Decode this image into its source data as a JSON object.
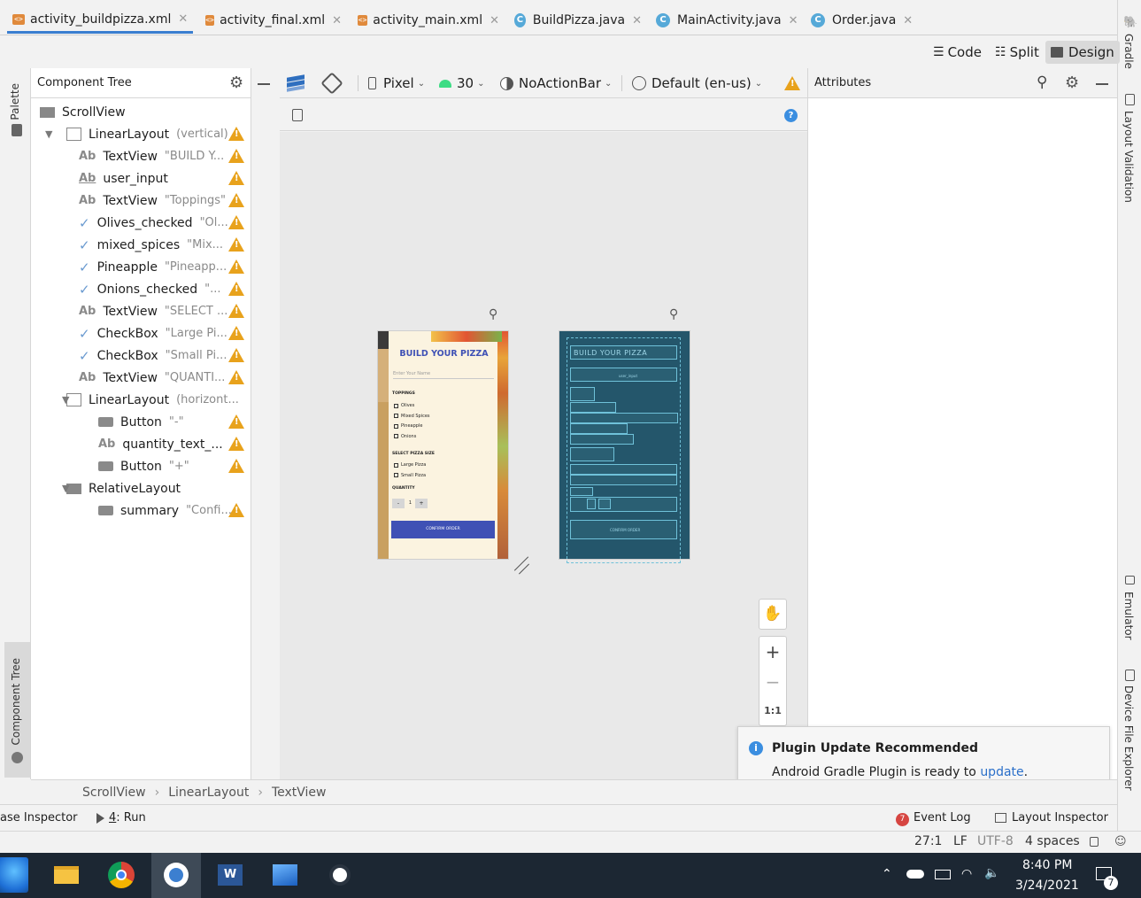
{
  "tabs": [
    {
      "label": "activity_buildpizza.xml",
      "type": "xml",
      "active": true
    },
    {
      "label": "activity_final.xml",
      "type": "xml"
    },
    {
      "label": "activity_main.xml",
      "type": "xml"
    },
    {
      "label": "BuildPizza.java",
      "type": "java"
    },
    {
      "label": "MainActivity.java",
      "type": "java"
    },
    {
      "label": "Order.java",
      "type": "java"
    }
  ],
  "view_modes": {
    "code": "Code",
    "split": "Split",
    "design": "Design",
    "active": "Design"
  },
  "left_strip": {
    "palette": "Palette",
    "component_tree": "Component Tree"
  },
  "right_strip": {
    "gradle": "Gradle",
    "layout_validation": "Layout Validation",
    "emulator": "Emulator",
    "device_file_explorer": "Device File Explorer"
  },
  "component_tree": {
    "title": "Component Tree",
    "rows": [
      {
        "icon": "scrollview",
        "name": "ScrollView",
        "attr": "",
        "warn": false
      },
      {
        "icon": "linearlayout-v",
        "name": "LinearLayout",
        "attr": "(vertical)",
        "warn": true,
        "expanded": true
      },
      {
        "icon": "textview",
        "name": "TextView",
        "attr": "\"BUILD Y...",
        "warn": true
      },
      {
        "icon": "edittext",
        "name": "user_input",
        "attr": "",
        "warn": true
      },
      {
        "icon": "textview",
        "name": "TextView",
        "attr": "\"Toppings\"",
        "warn": true
      },
      {
        "icon": "checkbox",
        "name": "Olives_checked",
        "attr": "\"Ol...",
        "warn": true
      },
      {
        "icon": "checkbox",
        "name": "mixed_spices",
        "attr": "\"Mix...",
        "warn": true
      },
      {
        "icon": "checkbox",
        "name": "Pineapple",
        "attr": "\"Pineapp...",
        "warn": true
      },
      {
        "icon": "checkbox",
        "name": "Onions_checked",
        "attr": "\"...",
        "warn": true
      },
      {
        "icon": "textview",
        "name": "TextView",
        "attr": "\"SELECT ...",
        "warn": true
      },
      {
        "icon": "checkbox",
        "name": "CheckBox",
        "attr": "\"Large Pi...",
        "warn": true
      },
      {
        "icon": "checkbox",
        "name": "CheckBox",
        "attr": "\"Small Pi...",
        "warn": true
      },
      {
        "icon": "textview",
        "name": "TextView",
        "attr": "\"QUANTI...",
        "warn": true
      },
      {
        "icon": "linearlayout-h",
        "name": "LinearLayout",
        "attr": "(horizont...",
        "warn": false,
        "expanded": true
      },
      {
        "icon": "button",
        "name": "Button",
        "attr": "\"-\"",
        "warn": true
      },
      {
        "icon": "textview",
        "name": "quantity_text_...",
        "attr": "",
        "warn": true
      },
      {
        "icon": "button",
        "name": "Button",
        "attr": "\"+\"",
        "warn": true
      },
      {
        "icon": "relativelayout",
        "name": "RelativeLayout",
        "attr": "",
        "warn": false,
        "expanded": true
      },
      {
        "icon": "button",
        "name": "summary",
        "attr": "\"Confi...",
        "warn": true
      }
    ]
  },
  "design_toolbar": {
    "device": "Pixel",
    "api": "30",
    "theme": "NoActionBar",
    "locale": "Default (en-us)"
  },
  "attributes": {
    "title": "Attributes"
  },
  "preview": {
    "title": "BUILD YOUR PIZZA",
    "input_placeholder": "Enter Your Name",
    "toppings_label": "TOPPINGS",
    "toppings": [
      "Olives",
      "Mixed Spices",
      "Pineapple",
      "Onions"
    ],
    "size_label": "SELECT PIZZA SIZE",
    "sizes": [
      "Large Pizza",
      "Small Pizza"
    ],
    "quantity_label": "QUANTITY",
    "minus": "-",
    "quantity": "1",
    "plus": "+",
    "confirm": "CONFIRM ORDER"
  },
  "blueprint": {
    "title": "BUILD YOUR PIZZA",
    "input": "user_input",
    "confirm": "CONFIRM ORDER"
  },
  "zoom": {
    "one_to_one": "1:1"
  },
  "notification": {
    "title": "Plugin Update Recommended",
    "body": "Android Gradle Plugin is ready to ",
    "link": "update",
    "suffix": "."
  },
  "breadcrumb": [
    "ScrollView",
    "LinearLayout",
    "TextView"
  ],
  "bottom_tools": {
    "left": "ase Inspector",
    "run_num": "4",
    "run": ": Run",
    "event_log": "Event Log",
    "event_count": "7",
    "layout_inspector": "Layout Inspector"
  },
  "status_bar": {
    "position": "27:1",
    "line_sep": "LF",
    "encoding": "UTF-8",
    "indent": "4 spaces"
  },
  "taskbar": {
    "time": "8:40 PM",
    "date": "3/24/2021",
    "notif_count": "7"
  }
}
